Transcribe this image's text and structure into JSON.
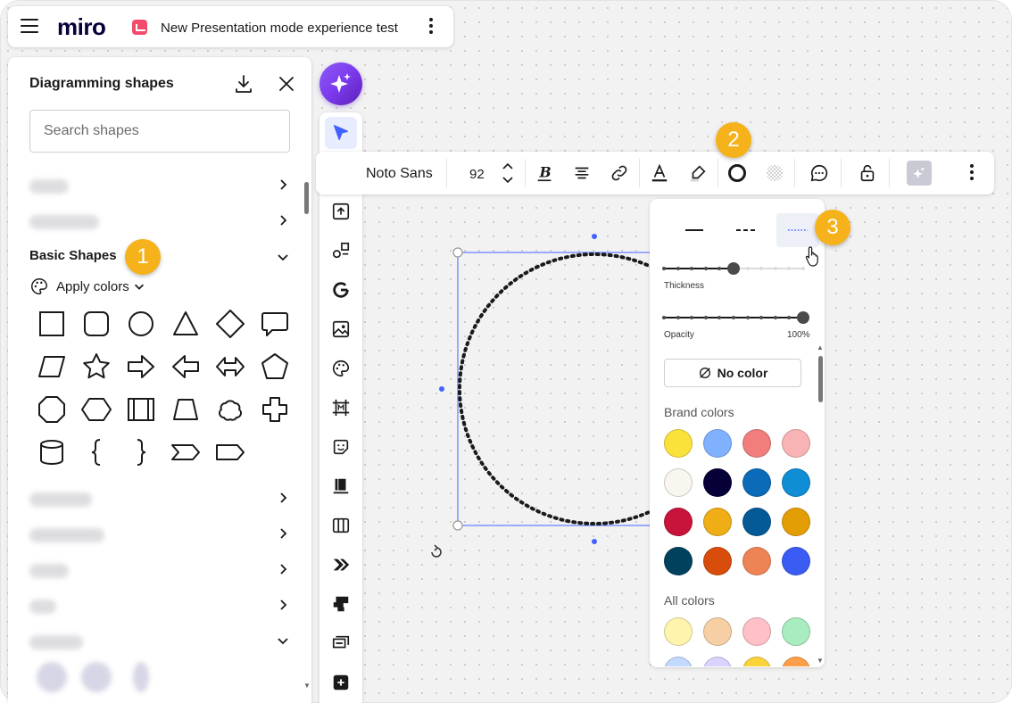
{
  "app": {
    "logo": "miro",
    "board_title": "New Presentation mode experience test"
  },
  "left_panel": {
    "title": "Diagramming shapes",
    "search_placeholder": "Search shapes",
    "section_title": "Basic Shapes",
    "apply_colors": "Apply colors",
    "shapes": [
      "rectangle",
      "rounded-rectangle",
      "circle",
      "triangle",
      "rhombus",
      "speech-bubble",
      "parallelogram",
      "star",
      "right-arrow",
      "left-arrow",
      "left-right-arrow",
      "pentagon",
      "octagon",
      "hexagon",
      "predefined-process",
      "trapezoid",
      "cloud",
      "cross",
      "cylinder",
      "left-brace",
      "right-brace",
      "chevron",
      "pentagon-label"
    ]
  },
  "toolbar": {
    "font": "Noto Sans",
    "font_size": "92"
  },
  "stroke_popover": {
    "line_styles": [
      "solid",
      "dashed",
      "dotted"
    ],
    "selected_style": "dotted",
    "thickness_label": "Thickness",
    "thickness_step": 5,
    "thickness_steps_total": 10,
    "opacity_label": "Opacity",
    "opacity_value": "100%",
    "no_color": "No color",
    "brand_colors_label": "Brand colors",
    "brand_colors": [
      "#fbe23a",
      "#80b1ff",
      "#f17d7d",
      "#f8b4b4",
      "#f8f6ee",
      "#050038",
      "#0b6bb8",
      "#0f8ed6",
      "#c8133a",
      "#efae16",
      "#045a96",
      "#e39e05",
      "#00425e",
      "#d84d0c",
      "#ee8455",
      "#3a5cf5"
    ],
    "all_colors_label": "All colors",
    "all_colors": [
      "#fff4ae",
      "#f7cfa4",
      "#ffc0c7",
      "#a8ecc0",
      "#c3d9ff",
      "#dcd2ff",
      "#fbd43a",
      "#ff9e4a"
    ]
  },
  "badges": [
    "1",
    "2",
    "3"
  ]
}
